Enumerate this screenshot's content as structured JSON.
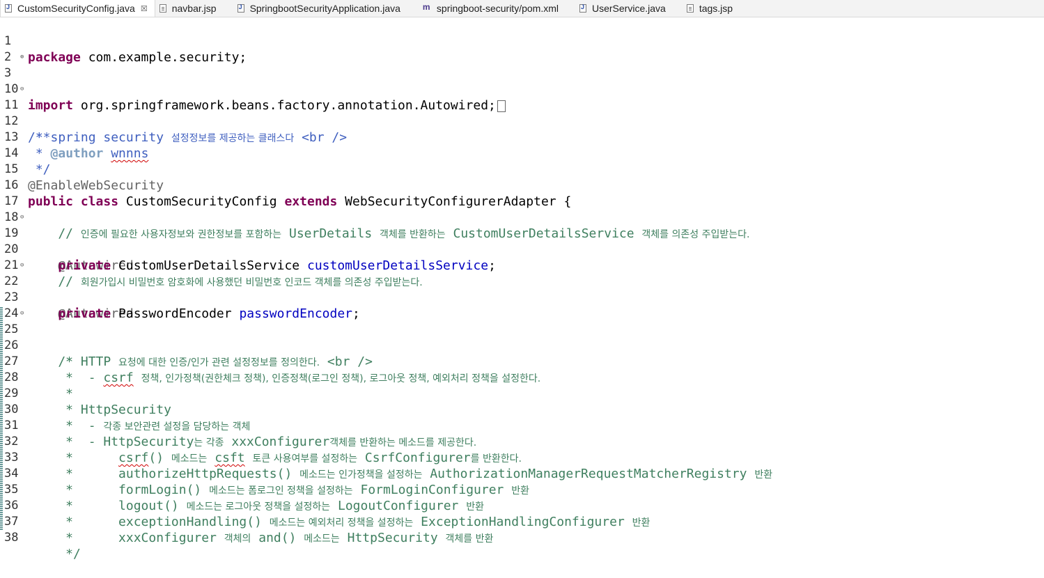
{
  "tabs": [
    {
      "label": "CustomSecurityConfig.java",
      "icon": "java-file-icon",
      "active": true,
      "close": "☒"
    },
    {
      "label": "navbar.jsp",
      "icon": "jsp-file-icon"
    },
    {
      "label": "SpringbootSecurityApplication.java",
      "icon": "java-file-icon"
    },
    {
      "label": "springboot-security/pom.xml",
      "icon": "maven-pom-icon"
    },
    {
      "label": "UserService.java",
      "icon": "java-file-icon"
    },
    {
      "label": "tags.jsp",
      "icon": "jsp-file-icon"
    }
  ],
  "lines": {
    "l1": {
      "n": "1",
      "t": [
        "package",
        " com.example.security;"
      ]
    },
    "l2": {
      "n": "2"
    },
    "l3": {
      "n": "3",
      "t": [
        "import",
        " org.springframework.beans.factory.annotation.Autowired;"
      ]
    },
    "l10": {
      "n": "10"
    },
    "l11": {
      "n": "11",
      "t": [
        "/**"
      ]
    },
    "l12": {
      "n": "12",
      "t": [
        " * spring security ",
        "설정정보를 제공하는 클래스다",
        " <br />"
      ]
    },
    "l13": {
      "n": "13",
      "t": [
        " * ",
        "@author",
        " ",
        "wnnns"
      ]
    },
    "l14": {
      "n": "14",
      "t": [
        " */"
      ]
    },
    "l15": {
      "n": "15",
      "t": [
        "@EnableWebSecurity"
      ]
    },
    "l16": {
      "n": "16",
      "t": [
        "public",
        " ",
        "class",
        " CustomSecurityConfig ",
        "extends",
        " WebSecurityConfigurerAdapter {"
      ]
    },
    "l17": {
      "n": "17"
    },
    "l18": {
      "n": "18",
      "t": [
        "    // ",
        "인증에 필요한 사용자정보와 권한정보를 포함하는",
        " UserDetails ",
        "객체를 반환하는",
        " CustomUserDetailsService ",
        "객체를 의존성 주입받는다."
      ]
    },
    "l19": {
      "n": "19",
      "t": [
        "    @Autowired"
      ]
    },
    "l20": {
      "n": "20",
      "t": [
        "    ",
        "private",
        " CustomUserDetailsService ",
        "customUserDetailsService",
        ";"
      ]
    },
    "l21": {
      "n": "21",
      "t": [
        "    // ",
        "회원가입시 비밀번호 암호화에 사용했던 비밀번호 인코드 객체를 의존성 주입받는다."
      ]
    },
    "l22": {
      "n": "22",
      "t": [
        "    @Autowired"
      ]
    },
    "l23": {
      "n": "23",
      "t": [
        "    ",
        "private",
        " PasswordEncoder ",
        "passwordEncoder",
        ";"
      ]
    },
    "l24": {
      "n": "24"
    },
    "l25": {
      "n": "25",
      "t": [
        "    /*"
      ]
    },
    "l26": {
      "n": "26",
      "t": [
        "     * HTTP ",
        "요청에 대한 인증/인가 관련 설정정보를 정의한다.",
        " <br />"
      ]
    },
    "l27": {
      "n": "27",
      "t": [
        "     *  - ",
        "csrf",
        " ",
        "정책, 인가정책(권한체크 정책), 인증정책(로그인 정책), 로그아웃 정책, 예외처리 정책을 설정한다."
      ]
    },
    "l28": {
      "n": "28",
      "t": [
        "     *"
      ]
    },
    "l29": {
      "n": "29",
      "t": [
        "     * HttpSecurity"
      ]
    },
    "l30": {
      "n": "30",
      "t": [
        "     *  - ",
        "각종 보안관련 설정을 담당하는 객체"
      ]
    },
    "l31": {
      "n": "31",
      "t": [
        "     *  - HttpSecurity",
        "는 각종",
        " xxxConfigurer",
        "객체를 반환하는 메소드를 제공한다."
      ]
    },
    "l32": {
      "n": "32",
      "t": [
        "     *      ",
        "csrf",
        "() ",
        "메소드는",
        " ",
        "csft",
        " ",
        "토큰 사용여부를 설정하는",
        " CsrfConfigurer",
        "를 반환한다."
      ]
    },
    "l33": {
      "n": "33",
      "t": [
        "     *      authorizeHttpRequests() ",
        "메소드는 인가정책을 설정하는",
        " AuthorizationManagerRequestMatcherRegistry ",
        "반환"
      ]
    },
    "l34": {
      "n": "34",
      "t": [
        "     *      formLogin() ",
        "메소드는 폼로그인 정책을 설정하는",
        " FormLoginConfigurer ",
        "반환"
      ]
    },
    "l35": {
      "n": "35",
      "t": [
        "     *      logout() ",
        "메소드는 로그아웃 정책을 설정하는",
        " LogoutConfigurer ",
        "반환"
      ]
    },
    "l36": {
      "n": "36",
      "t": [
        "     *      exceptionHandling() ",
        "메소드는 예외처리 정책을 설정하는",
        " ExceptionHandlingConfigurer ",
        "반환"
      ]
    },
    "l37": {
      "n": "37",
      "t": [
        "     *      xxxConfigurer ",
        "객체의",
        " and() ",
        "메소드는",
        " HttpSecurity ",
        "객체를 반환"
      ]
    },
    "l38": {
      "n": "38",
      "t": [
        "     */"
      ]
    }
  },
  "fold_markers": {
    "expand": "⊕",
    "collapse": "⊖"
  },
  "colors": {
    "keyword": "#7f0055",
    "javadoc": "#3f5fbf",
    "javadoc_tag": "#7f9fbf",
    "comment": "#3f7f5f",
    "field": "#0000c0",
    "annotation": "#646464"
  }
}
